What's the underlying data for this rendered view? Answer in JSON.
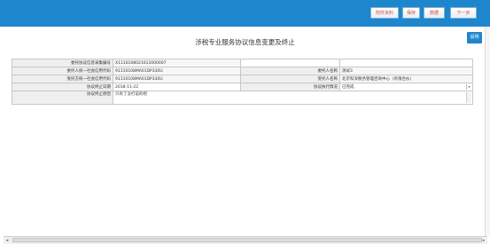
{
  "toolbar": {
    "buttons": [
      "附件资料",
      "保存",
      "数据",
      "下一步"
    ]
  },
  "side_button": "说明",
  "page_title": "涉税专业服务协议信息变更及终止",
  "form": {
    "row1": {
      "label1": "委托协议信息采集编号",
      "value1": "X1110108021611000007",
      "label2": "",
      "value2": ""
    },
    "row2": {
      "label1": "委托人统一社会信用代码",
      "value1": "91110108MA01DP330U",
      "label2": "委托人名称",
      "value2": "测试3"
    },
    "row3": {
      "label1": "受托方统一社会信用代码",
      "value1": "91110108MA01DP330U",
      "label2": "受托人名称",
      "value2": "北京科深税务管理咨询中心（有限合伙）"
    },
    "row4": {
      "label1": "协议终止日期",
      "value1": "2018-11-22",
      "label2": "协议执行情况",
      "value2": "已完成"
    },
    "row5": {
      "label1": "协议终止原因",
      "value1": "只有了没打说的吧"
    }
  },
  "colors": {
    "header_bg": "#1e86cc",
    "label_bg": "#efefef",
    "button_text": "#d04a3a"
  }
}
